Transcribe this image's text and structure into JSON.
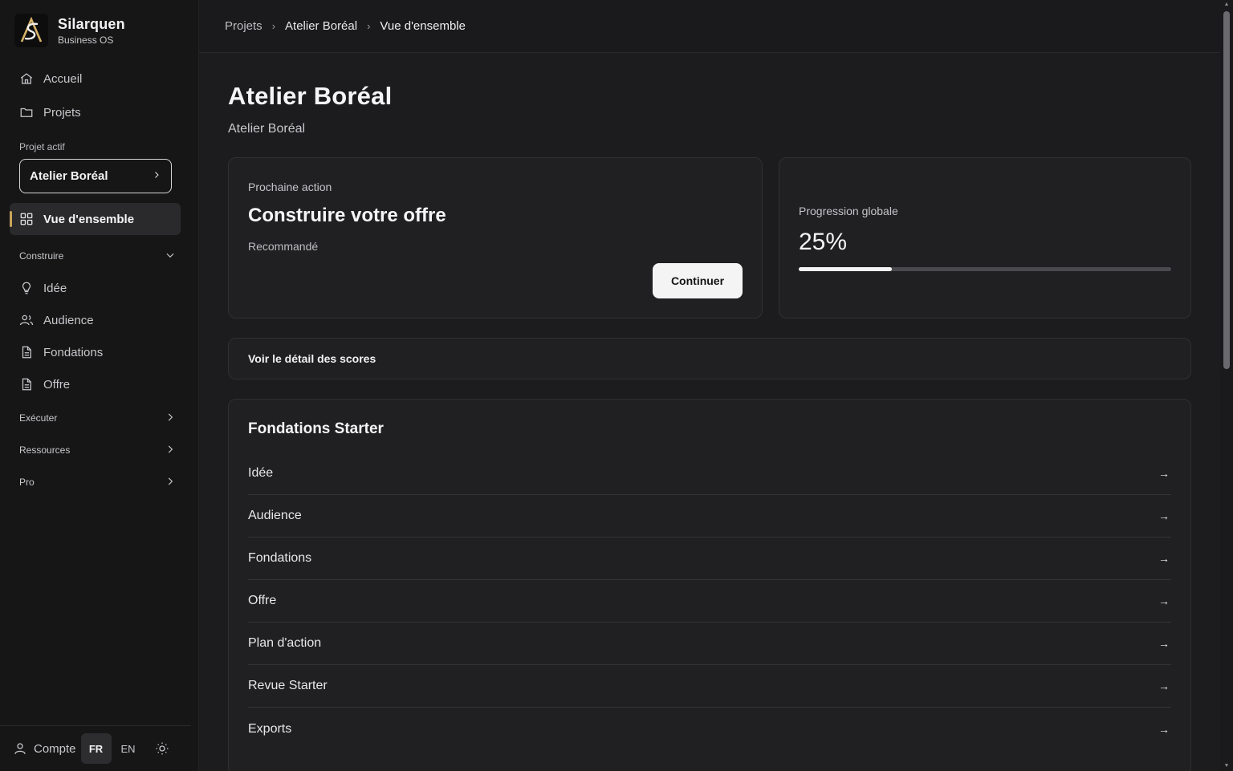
{
  "brand": {
    "name": "Silarquen",
    "subtitle": "Business OS"
  },
  "sidebar": {
    "nav": [
      {
        "label": "Accueil",
        "icon": "home-icon"
      },
      {
        "label": "Projets",
        "icon": "folder-icon"
      }
    ],
    "active_project_label": "Projet actif",
    "active_project_name": "Atelier Boréal",
    "active_item": {
      "label": "Vue d'ensemble",
      "icon": "grid-icon"
    },
    "groups": {
      "construire": {
        "label": "Construire",
        "items": [
          {
            "label": "Idée",
            "icon": "lightbulb-icon"
          },
          {
            "label": "Audience",
            "icon": "users-icon"
          },
          {
            "label": "Fondations",
            "icon": "document-icon"
          },
          {
            "label": "Offre",
            "icon": "document-icon"
          }
        ]
      },
      "executer": {
        "label": "Exécuter"
      },
      "ressources": {
        "label": "Ressources"
      },
      "pro": {
        "label": "Pro"
      }
    },
    "footer": {
      "account": "Compte",
      "lang_fr": "FR",
      "lang_en": "EN",
      "active_lang": "FR"
    }
  },
  "breadcrumb": [
    "Projets",
    "Atelier Boréal",
    "Vue d'ensemble"
  ],
  "page": {
    "title": "Atelier Boréal",
    "subtitle": "Atelier Boréal"
  },
  "next_action": {
    "label": "Prochaine action",
    "title": "Construire votre offre",
    "tag": "Recommandé",
    "button": "Continuer"
  },
  "progress": {
    "label": "Progression globale",
    "value_text": "25%",
    "value": 0.25
  },
  "scores_link": "Voir le détail des scores",
  "foundations": {
    "title": "Fondations Starter",
    "items": [
      "Idée",
      "Audience",
      "Fondations",
      "Offre",
      "Plan d'action",
      "Revue Starter",
      "Exports"
    ],
    "arrow": "→"
  },
  "colors": {
    "accent": "#c9a45a",
    "background": "#1c1c1e",
    "sidebar": "#161617",
    "card": "#202022",
    "button": "#f4f4f5"
  }
}
